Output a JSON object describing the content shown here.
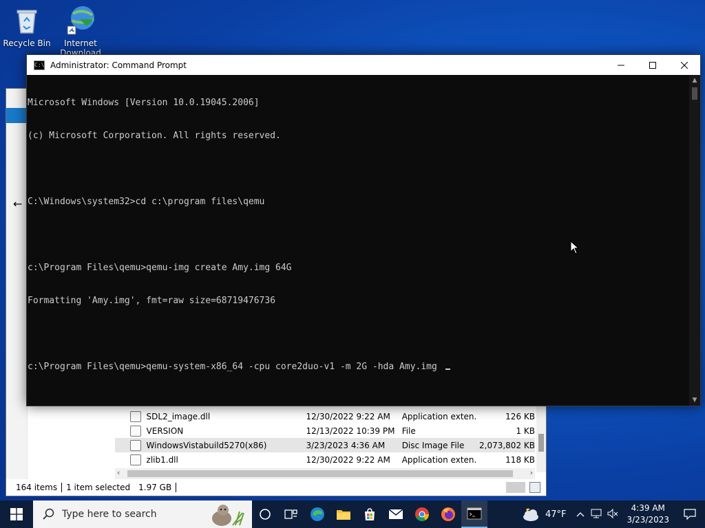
{
  "desktop": {
    "icons": [
      {
        "label": "Recycle Bin"
      },
      {
        "label": "Internet Download"
      }
    ]
  },
  "explorer": {
    "files": [
      {
        "name": "SDL2_image.dll",
        "date": "12/30/2022 9:22 AM",
        "type": "Application exten...",
        "size": "126 KB"
      },
      {
        "name": "VERSION",
        "date": "12/13/2022 10:39 PM",
        "type": "File",
        "size": "1 KB"
      },
      {
        "name": "WindowsVistabuild5270(x86)",
        "date": "3/23/2023 4:36 AM",
        "type": "Disc Image File",
        "size": "2,073,802 KB"
      },
      {
        "name": "zlib1.dll",
        "date": "12/30/2022 9:22 AM",
        "type": "Application exten...",
        "size": "118 KB"
      }
    ],
    "status": {
      "items": "164 items",
      "selected": "1 item selected",
      "size": "1.97 GB"
    }
  },
  "cmd": {
    "title": "Administrator: Command Prompt",
    "lines": [
      "Microsoft Windows [Version 10.0.19045.2006]",
      "(c) Microsoft Corporation. All rights reserved.",
      "",
      "C:\\Windows\\system32>cd c:\\program files\\qemu",
      "",
      "c:\\Program Files\\qemu>qemu-img create Amy.img 64G",
      "Formatting 'Amy.img', fmt=raw size=68719476736",
      "",
      "c:\\Program Files\\qemu>qemu-system-x86_64 -cpu core2duo-v1 -m 2G -hda Amy.img "
    ]
  },
  "taskbar": {
    "search_placeholder": "Type here to search",
    "weather": "47°F",
    "time": "4:39 AM",
    "date": "3/23/2023"
  },
  "colors": {
    "accent": "#0078d7",
    "terminal_bg": "#0c0c0c",
    "terminal_fg": "#cccccc",
    "taskbar": "#0c1e3a"
  }
}
